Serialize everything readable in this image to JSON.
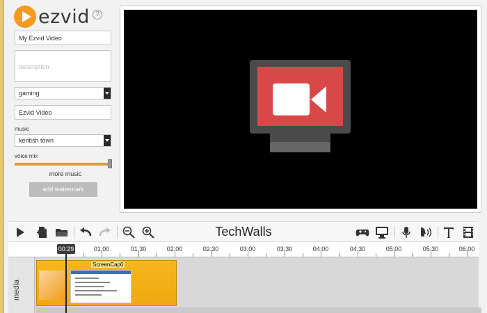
{
  "app": {
    "logo_text": "ezvid",
    "help_glyph": "?"
  },
  "sidebar": {
    "title_value": "My Ezvid Video",
    "description_placeholder": "description",
    "category_value": "gaming",
    "credit_value": "Ezvid Video",
    "music_label": "music",
    "music_value": "kentish town",
    "voice_mix_label": "voice mix",
    "voice_mix_level": 0.97,
    "more_music": "more music",
    "watermark_button": "add watermark"
  },
  "toolbar": {
    "project_title": "TechWalls",
    "icons": [
      "play-icon",
      "new-file-icon",
      "open-folder-icon",
      "undo-icon",
      "redo-icon",
      "zoom-out-icon",
      "zoom-in-icon",
      "gamepad-icon",
      "monitor-icon",
      "microphone-icon",
      "speech-icon",
      "text-icon",
      "film-icon"
    ]
  },
  "timeline": {
    "playhead_time": "00:29",
    "ticks": [
      "01:00",
      "01:30",
      "02:00",
      "02:30",
      "03:00",
      "03:30",
      "04:00",
      "04:30",
      "05:00",
      "05:30",
      "06:00"
    ],
    "track_label": "media",
    "clip_title": "ScreenCap0"
  },
  "colors": {
    "accent": "#f39a1f",
    "clip": "#f6b71c",
    "preview_bg": "#000000",
    "cam_red": "#d94848",
    "cam_frame": "#4a4a4a"
  }
}
